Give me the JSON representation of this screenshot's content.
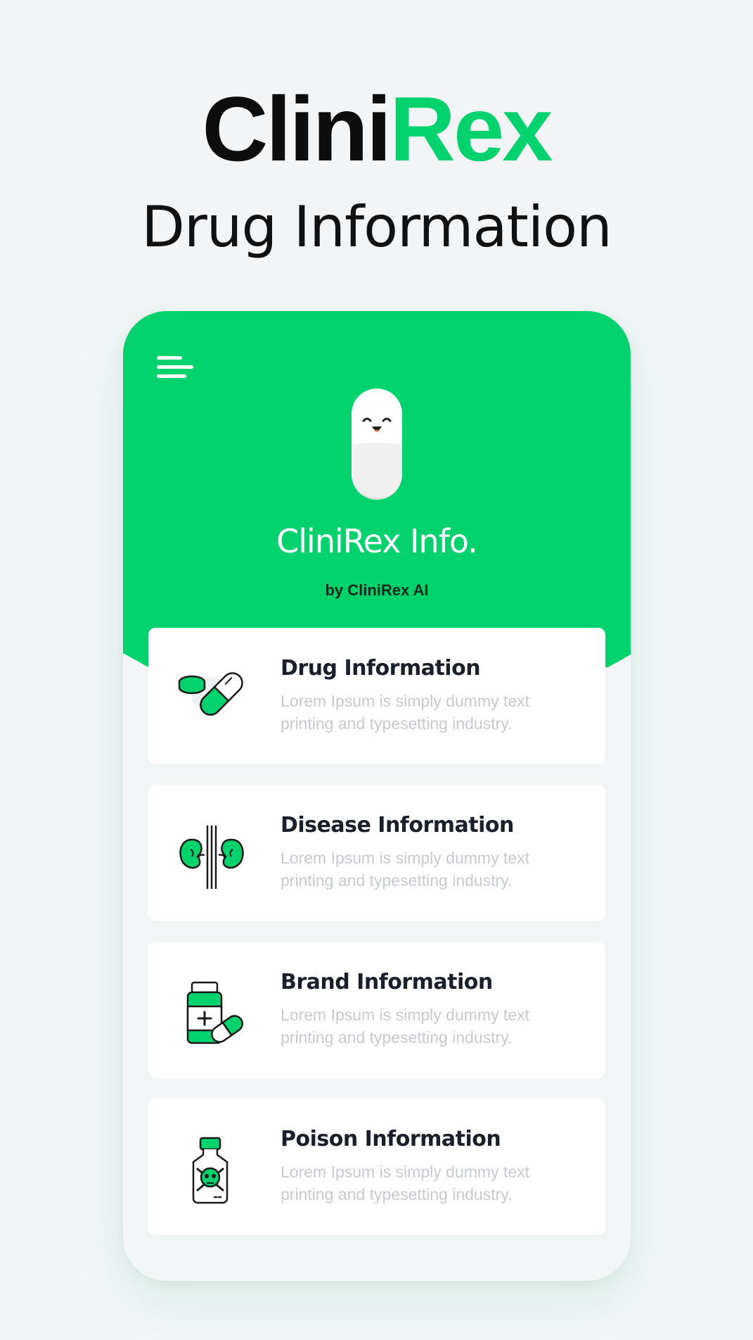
{
  "brand": {
    "part1": "Clini",
    "part2": "Rex",
    "accent": "#02d26e"
  },
  "headline": "Drug Information",
  "app": {
    "title": "CliniRex Info.",
    "byline": "by CliniRex AI",
    "menu_icon": "hamburger-menu-icon",
    "mascot_icon": "smiling-pill-mascot-icon"
  },
  "cards": [
    {
      "title": "Drug Information",
      "desc": "Lorem Ipsum is simply dummy text printing and typesetting industry.",
      "icon": "pills-capsule-icon"
    },
    {
      "title": "Disease Information",
      "desc": "Lorem Ipsum is simply dummy text printing and typesetting industry.",
      "icon": "kidneys-icon"
    },
    {
      "title": "Brand Information",
      "desc": "Lorem Ipsum is simply dummy text printing and typesetting industry.",
      "icon": "medicine-bottle-icon"
    },
    {
      "title": "Poison Information",
      "desc": "Lorem Ipsum is simply dummy text printing and typesetting industry.",
      "icon": "poison-bottle-icon"
    }
  ]
}
